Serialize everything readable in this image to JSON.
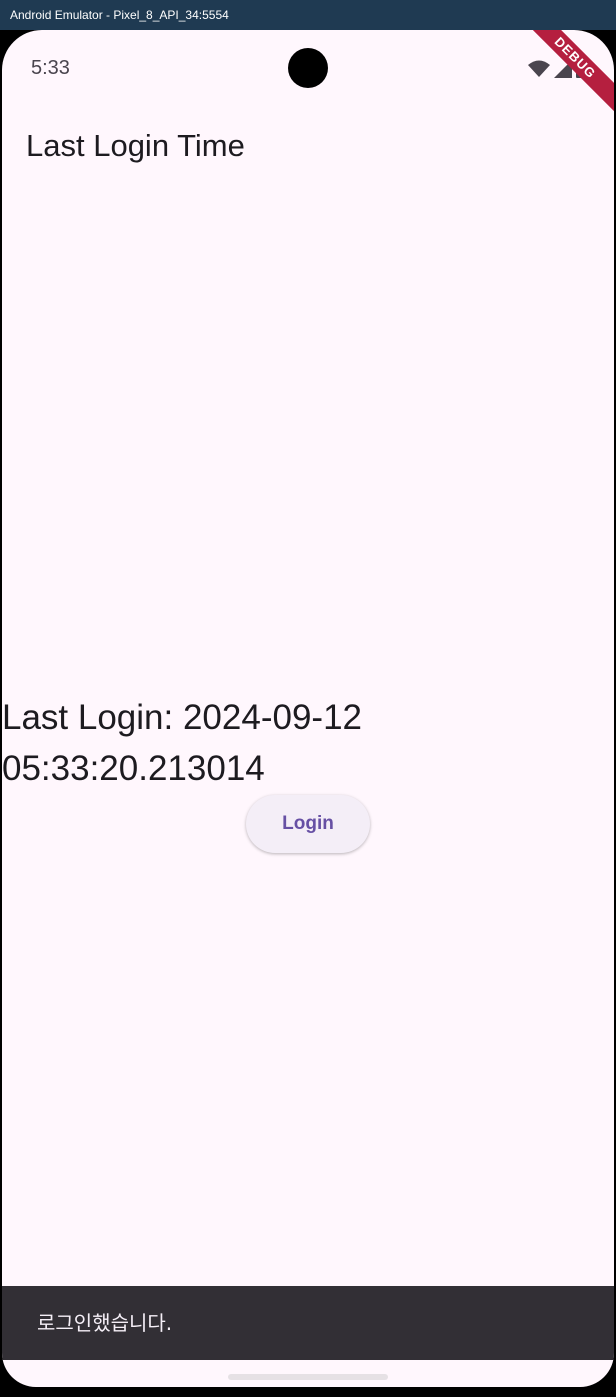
{
  "window": {
    "title": "Android Emulator - Pixel_8_API_34:5554"
  },
  "status_bar": {
    "time": "5:33",
    "icons": [
      "wifi-icon",
      "signal-icon",
      "battery-icon"
    ]
  },
  "debug_banner": {
    "label": "DEBUG"
  },
  "app_bar": {
    "title": "Last Login Time"
  },
  "content": {
    "last_login_text": "Last Login: 2024-09-12 05:33:20.213014",
    "login_button_label": "Login"
  },
  "snackbar": {
    "message": "로그인했습니다."
  },
  "colors": {
    "background": "#fff7fd",
    "primary": "#6750a4",
    "debug_banner": "#b51f3f",
    "snackbar": "#322f35"
  }
}
